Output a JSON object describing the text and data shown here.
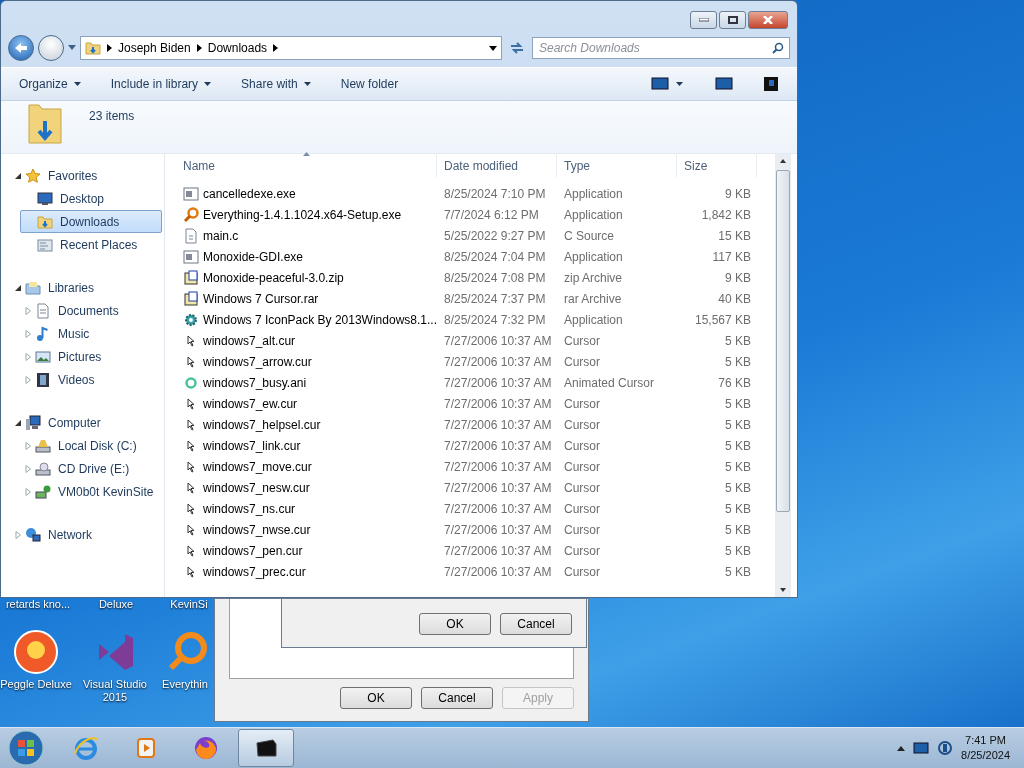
{
  "explorer": {
    "address": [
      "Joseph Biden",
      "Downloads"
    ],
    "search": {
      "placeholder": "Search Downloads"
    },
    "toolbar": [
      {
        "label": "Organize",
        "menu": true
      },
      {
        "label": "Include in library",
        "menu": true
      },
      {
        "label": "Share with",
        "menu": true
      },
      {
        "label": "New folder",
        "menu": false
      }
    ],
    "item_count": "23 items",
    "nav": [
      {
        "label": "Favorites",
        "kind": "star",
        "expanded": true,
        "selected": false,
        "children": [
          {
            "label": "Desktop",
            "kind": "desktop",
            "selected": false
          },
          {
            "label": "Downloads",
            "kind": "downloads",
            "selected": true
          },
          {
            "label": "Recent Places",
            "kind": "recent",
            "selected": false
          }
        ]
      },
      {
        "label": "Libraries",
        "kind": "library",
        "expanded": true,
        "selected": false,
        "children": [
          {
            "label": "Documents",
            "kind": "documents",
            "expanded": false,
            "selected": false
          },
          {
            "label": "Music",
            "kind": "music",
            "expanded": false,
            "selected": false
          },
          {
            "label": "Pictures",
            "kind": "pictures",
            "expanded": false,
            "selected": false
          },
          {
            "label": "Videos",
            "kind": "videos",
            "expanded": false,
            "selected": false
          }
        ]
      },
      {
        "label": "Computer",
        "kind": "computer",
        "expanded": true,
        "selected": false,
        "children": [
          {
            "label": "Local Disk (C:)",
            "kind": "disk",
            "expanded": false,
            "selected": false
          },
          {
            "label": "CD Drive (E:)",
            "kind": "cd",
            "expanded": false,
            "selected": false
          },
          {
            "label": "VM0b0t KevinSite",
            "kind": "netdrive",
            "expanded": false,
            "selected": false
          }
        ]
      },
      {
        "label": "Network",
        "kind": "network",
        "expanded": false,
        "selected": false
      }
    ],
    "columns": [
      "Name",
      "Date modified",
      "Type",
      "Size"
    ],
    "files": [
      {
        "name": "cancelledexe.exe",
        "kind": "exe",
        "date": "8/25/2024 7:10 PM",
        "type": "Application",
        "size": "9 KB"
      },
      {
        "name": "Everything-1.4.1.1024.x64-Setup.exe",
        "kind": "magnifier",
        "date": "7/7/2024 6:12 PM",
        "type": "Application",
        "size": "1,842 KB"
      },
      {
        "name": "main.c",
        "kind": "document",
        "date": "5/25/2022 9:27 PM",
        "type": "C Source",
        "size": "15 KB"
      },
      {
        "name": "Monoxide-GDI.exe",
        "kind": "exe",
        "date": "8/25/2024 7:04 PM",
        "type": "Application",
        "size": "117 KB"
      },
      {
        "name": "Monoxide-peaceful-3.0.zip",
        "kind": "zip",
        "date": "8/25/2024 7:08 PM",
        "type": "zip Archive",
        "size": "9 KB"
      },
      {
        "name": "Windows 7 Cursor.rar",
        "kind": "rar",
        "date": "8/25/2024 7:37 PM",
        "type": "rar Archive",
        "size": "40 KB"
      },
      {
        "name": "Windows 7 IconPack By 2013Windows8.1...",
        "kind": "gear",
        "date": "8/25/2024 7:32 PM",
        "type": "Application",
        "size": "15,567 KB"
      },
      {
        "name": "windows7_alt.cur",
        "kind": "cursor",
        "date": "7/27/2006 10:37 AM",
        "type": "Cursor",
        "size": "5 KB"
      },
      {
        "name": "windows7_arrow.cur",
        "kind": "cursor",
        "date": "7/27/2006 10:37 AM",
        "type": "Cursor",
        "size": "5 KB"
      },
      {
        "name": "windows7_busy.ani",
        "kind": "busy",
        "date": "7/27/2006 10:37 AM",
        "type": "Animated Cursor",
        "size": "76 KB"
      },
      {
        "name": "windows7_ew.cur",
        "kind": "cursor",
        "date": "7/27/2006 10:37 AM",
        "type": "Cursor",
        "size": "5 KB"
      },
      {
        "name": "windows7_helpsel.cur",
        "kind": "cursor",
        "date": "7/27/2006 10:37 AM",
        "type": "Cursor",
        "size": "5 KB"
      },
      {
        "name": "windows7_link.cur",
        "kind": "cursor",
        "date": "7/27/2006 10:37 AM",
        "type": "Cursor",
        "size": "5 KB"
      },
      {
        "name": "windows7_move.cur",
        "kind": "cursor",
        "date": "7/27/2006 10:37 AM",
        "type": "Cursor",
        "size": "5 KB"
      },
      {
        "name": "windows7_nesw.cur",
        "kind": "cursor",
        "date": "7/27/2006 10:37 AM",
        "type": "Cursor",
        "size": "5 KB"
      },
      {
        "name": "windows7_ns.cur",
        "kind": "cursor",
        "date": "7/27/2006 10:37 AM",
        "type": "Cursor",
        "size": "5 KB"
      },
      {
        "name": "windows7_nwse.cur",
        "kind": "cursor",
        "date": "7/27/2006 10:37 AM",
        "type": "Cursor",
        "size": "5 KB"
      },
      {
        "name": "windows7_pen.cur",
        "kind": "cursor",
        "date": "7/27/2006 10:37 AM",
        "type": "Cursor",
        "size": "5 KB"
      },
      {
        "name": "windows7_prec.cur",
        "kind": "cursor",
        "date": "7/27/2006 10:37 AM",
        "type": "Cursor",
        "size": "5 KB"
      }
    ]
  },
  "dialogs": [
    {
      "buttons": [
        {
          "label": "OK",
          "disabled": false
        },
        {
          "label": "Cancel",
          "disabled": false
        }
      ]
    },
    {
      "buttons": [
        {
          "label": "OK",
          "disabled": false
        },
        {
          "label": "Cancel",
          "disabled": false
        },
        {
          "label": "Apply",
          "disabled": true
        }
      ]
    }
  ],
  "desktop_labels": [
    "retards kno...",
    "Deluxe",
    "KevinSi"
  ],
  "desktop_icons": [
    {
      "label": "Peggle Deluxe",
      "kind": "peggle"
    },
    {
      "label": "Visual Studio 2015",
      "kind": "vs"
    },
    {
      "label": "Everythin",
      "kind": "everything"
    }
  ],
  "taskbar": {
    "apps": [
      {
        "kind": "ie",
        "active": false
      },
      {
        "kind": "media",
        "active": false
      },
      {
        "kind": "firefox",
        "active": false
      },
      {
        "kind": "app",
        "active": true
      }
    ],
    "time": "7:41 PM",
    "date": "8/25/2024"
  }
}
